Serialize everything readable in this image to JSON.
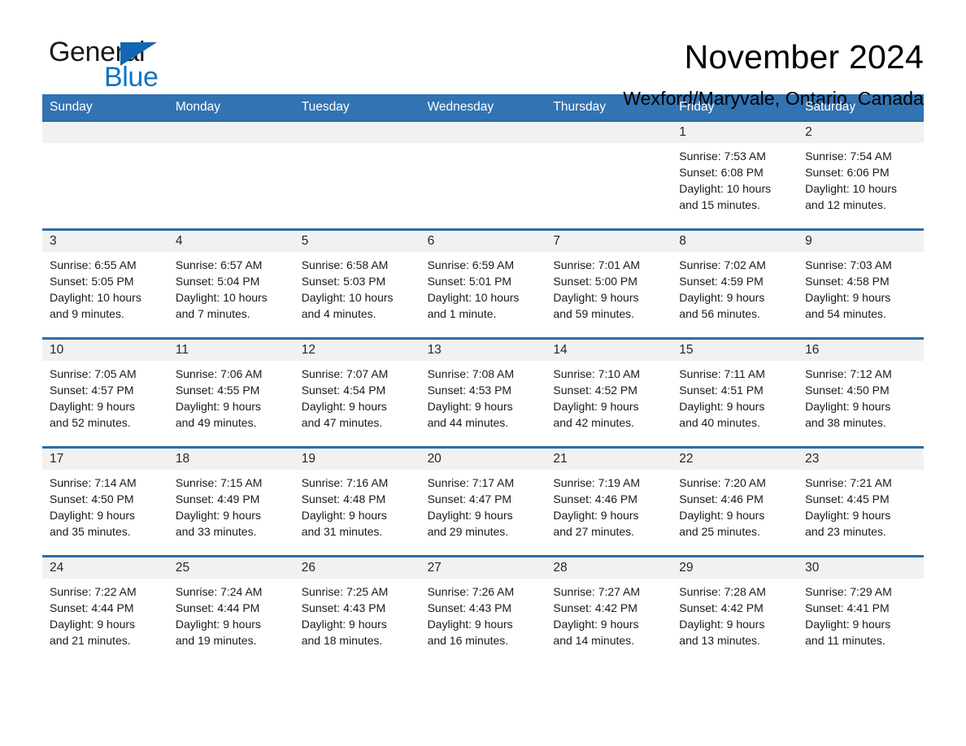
{
  "logo": {
    "word1": "General",
    "word2": "Blue",
    "triangle_color": "#1168b0",
    "blue_color": "#1174c2"
  },
  "header": {
    "month_title": "November 2024",
    "location": "Wexford/Maryvale, Ontario, Canada"
  },
  "theme": {
    "header_blue": "#3273b3",
    "row_border_blue": "#2e6da4",
    "day_band_gray": "#f1f1f1"
  },
  "weekdays": [
    "Sunday",
    "Monday",
    "Tuesday",
    "Wednesday",
    "Thursday",
    "Friday",
    "Saturday"
  ],
  "weeks": [
    [
      {
        "day": "",
        "empty": true
      },
      {
        "day": "",
        "empty": true
      },
      {
        "day": "",
        "empty": true
      },
      {
        "day": "",
        "empty": true
      },
      {
        "day": "",
        "empty": true
      },
      {
        "day": "1",
        "sunrise": "Sunrise: 7:53 AM",
        "sunset": "Sunset: 6:08 PM",
        "daylight_line1": "Daylight: 10 hours",
        "daylight_line2": "and 15 minutes."
      },
      {
        "day": "2",
        "sunrise": "Sunrise: 7:54 AM",
        "sunset": "Sunset: 6:06 PM",
        "daylight_line1": "Daylight: 10 hours",
        "daylight_line2": "and 12 minutes."
      }
    ],
    [
      {
        "day": "3",
        "sunrise": "Sunrise: 6:55 AM",
        "sunset": "Sunset: 5:05 PM",
        "daylight_line1": "Daylight: 10 hours",
        "daylight_line2": "and 9 minutes."
      },
      {
        "day": "4",
        "sunrise": "Sunrise: 6:57 AM",
        "sunset": "Sunset: 5:04 PM",
        "daylight_line1": "Daylight: 10 hours",
        "daylight_line2": "and 7 minutes."
      },
      {
        "day": "5",
        "sunrise": "Sunrise: 6:58 AM",
        "sunset": "Sunset: 5:03 PM",
        "daylight_line1": "Daylight: 10 hours",
        "daylight_line2": "and 4 minutes."
      },
      {
        "day": "6",
        "sunrise": "Sunrise: 6:59 AM",
        "sunset": "Sunset: 5:01 PM",
        "daylight_line1": "Daylight: 10 hours",
        "daylight_line2": "and 1 minute."
      },
      {
        "day": "7",
        "sunrise": "Sunrise: 7:01 AM",
        "sunset": "Sunset: 5:00 PM",
        "daylight_line1": "Daylight: 9 hours",
        "daylight_line2": "and 59 minutes."
      },
      {
        "day": "8",
        "sunrise": "Sunrise: 7:02 AM",
        "sunset": "Sunset: 4:59 PM",
        "daylight_line1": "Daylight: 9 hours",
        "daylight_line2": "and 56 minutes."
      },
      {
        "day": "9",
        "sunrise": "Sunrise: 7:03 AM",
        "sunset": "Sunset: 4:58 PM",
        "daylight_line1": "Daylight: 9 hours",
        "daylight_line2": "and 54 minutes."
      }
    ],
    [
      {
        "day": "10",
        "sunrise": "Sunrise: 7:05 AM",
        "sunset": "Sunset: 4:57 PM",
        "daylight_line1": "Daylight: 9 hours",
        "daylight_line2": "and 52 minutes."
      },
      {
        "day": "11",
        "sunrise": "Sunrise: 7:06 AM",
        "sunset": "Sunset: 4:55 PM",
        "daylight_line1": "Daylight: 9 hours",
        "daylight_line2": "and 49 minutes."
      },
      {
        "day": "12",
        "sunrise": "Sunrise: 7:07 AM",
        "sunset": "Sunset: 4:54 PM",
        "daylight_line1": "Daylight: 9 hours",
        "daylight_line2": "and 47 minutes."
      },
      {
        "day": "13",
        "sunrise": "Sunrise: 7:08 AM",
        "sunset": "Sunset: 4:53 PM",
        "daylight_line1": "Daylight: 9 hours",
        "daylight_line2": "and 44 minutes."
      },
      {
        "day": "14",
        "sunrise": "Sunrise: 7:10 AM",
        "sunset": "Sunset: 4:52 PM",
        "daylight_line1": "Daylight: 9 hours",
        "daylight_line2": "and 42 minutes."
      },
      {
        "day": "15",
        "sunrise": "Sunrise: 7:11 AM",
        "sunset": "Sunset: 4:51 PM",
        "daylight_line1": "Daylight: 9 hours",
        "daylight_line2": "and 40 minutes."
      },
      {
        "day": "16",
        "sunrise": "Sunrise: 7:12 AM",
        "sunset": "Sunset: 4:50 PM",
        "daylight_line1": "Daylight: 9 hours",
        "daylight_line2": "and 38 minutes."
      }
    ],
    [
      {
        "day": "17",
        "sunrise": "Sunrise: 7:14 AM",
        "sunset": "Sunset: 4:50 PM",
        "daylight_line1": "Daylight: 9 hours",
        "daylight_line2": "and 35 minutes."
      },
      {
        "day": "18",
        "sunrise": "Sunrise: 7:15 AM",
        "sunset": "Sunset: 4:49 PM",
        "daylight_line1": "Daylight: 9 hours",
        "daylight_line2": "and 33 minutes."
      },
      {
        "day": "19",
        "sunrise": "Sunrise: 7:16 AM",
        "sunset": "Sunset: 4:48 PM",
        "daylight_line1": "Daylight: 9 hours",
        "daylight_line2": "and 31 minutes."
      },
      {
        "day": "20",
        "sunrise": "Sunrise: 7:17 AM",
        "sunset": "Sunset: 4:47 PM",
        "daylight_line1": "Daylight: 9 hours",
        "daylight_line2": "and 29 minutes."
      },
      {
        "day": "21",
        "sunrise": "Sunrise: 7:19 AM",
        "sunset": "Sunset: 4:46 PM",
        "daylight_line1": "Daylight: 9 hours",
        "daylight_line2": "and 27 minutes."
      },
      {
        "day": "22",
        "sunrise": "Sunrise: 7:20 AM",
        "sunset": "Sunset: 4:46 PM",
        "daylight_line1": "Daylight: 9 hours",
        "daylight_line2": "and 25 minutes."
      },
      {
        "day": "23",
        "sunrise": "Sunrise: 7:21 AM",
        "sunset": "Sunset: 4:45 PM",
        "daylight_line1": "Daylight: 9 hours",
        "daylight_line2": "and 23 minutes."
      }
    ],
    [
      {
        "day": "24",
        "sunrise": "Sunrise: 7:22 AM",
        "sunset": "Sunset: 4:44 PM",
        "daylight_line1": "Daylight: 9 hours",
        "daylight_line2": "and 21 minutes."
      },
      {
        "day": "25",
        "sunrise": "Sunrise: 7:24 AM",
        "sunset": "Sunset: 4:44 PM",
        "daylight_line1": "Daylight: 9 hours",
        "daylight_line2": "and 19 minutes."
      },
      {
        "day": "26",
        "sunrise": "Sunrise: 7:25 AM",
        "sunset": "Sunset: 4:43 PM",
        "daylight_line1": "Daylight: 9 hours",
        "daylight_line2": "and 18 minutes."
      },
      {
        "day": "27",
        "sunrise": "Sunrise: 7:26 AM",
        "sunset": "Sunset: 4:43 PM",
        "daylight_line1": "Daylight: 9 hours",
        "daylight_line2": "and 16 minutes."
      },
      {
        "day": "28",
        "sunrise": "Sunrise: 7:27 AM",
        "sunset": "Sunset: 4:42 PM",
        "daylight_line1": "Daylight: 9 hours",
        "daylight_line2": "and 14 minutes."
      },
      {
        "day": "29",
        "sunrise": "Sunrise: 7:28 AM",
        "sunset": "Sunset: 4:42 PM",
        "daylight_line1": "Daylight: 9 hours",
        "daylight_line2": "and 13 minutes."
      },
      {
        "day": "30",
        "sunrise": "Sunrise: 7:29 AM",
        "sunset": "Sunset: 4:41 PM",
        "daylight_line1": "Daylight: 9 hours",
        "daylight_line2": "and 11 minutes."
      }
    ]
  ]
}
